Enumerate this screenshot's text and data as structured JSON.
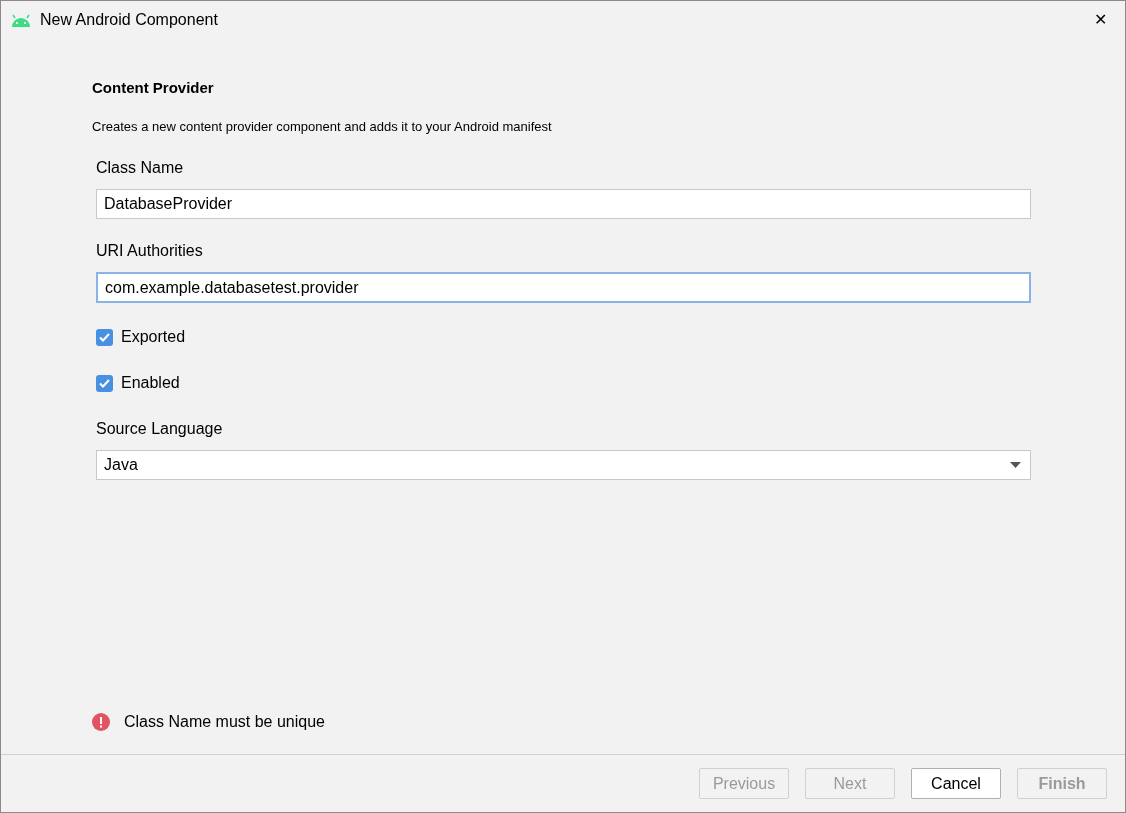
{
  "window": {
    "title": "New Android Component",
    "close": "✕"
  },
  "heading": "Content Provider",
  "description": "Creates a new content provider component and adds it to your Android manifest",
  "fields": [
    {
      "kind": "text",
      "label": "Class Name",
      "value": "DatabaseProvider",
      "focused": false
    },
    {
      "kind": "text",
      "label": "URI Authorities",
      "value": "com.example.databasetest.provider",
      "focused": true
    },
    {
      "kind": "checkbox",
      "label": "Exported",
      "checked": true
    },
    {
      "kind": "checkbox",
      "label": "Enabled",
      "checked": true
    },
    {
      "kind": "dropdown",
      "label": "Source Language",
      "value": "Java"
    }
  ],
  "error": "Class Name must be unique",
  "buttons": [
    {
      "label": "Previous",
      "disabled": true,
      "default": false
    },
    {
      "label": "Next",
      "disabled": true,
      "default": false
    },
    {
      "label": "Cancel",
      "disabled": false,
      "default": false
    },
    {
      "label": "Finish",
      "disabled": true,
      "default": true
    }
  ]
}
